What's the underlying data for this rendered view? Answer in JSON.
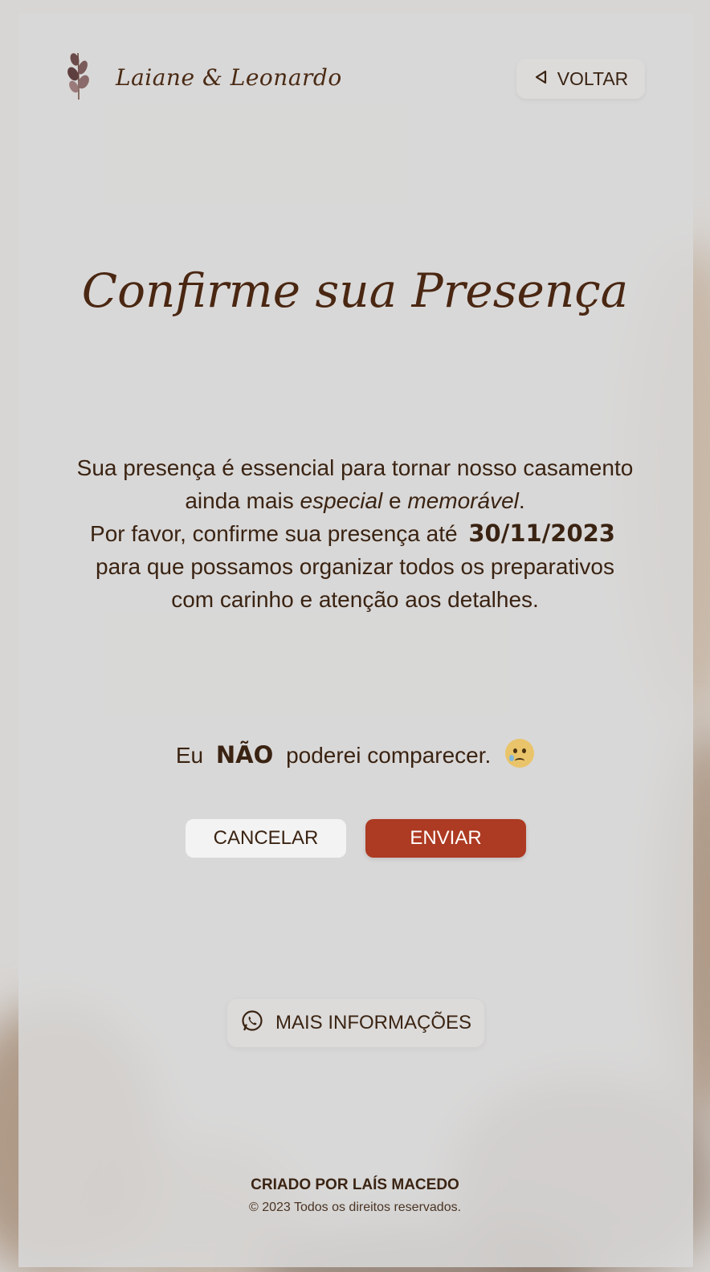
{
  "header": {
    "couple_name": "Laiane & Leonardo",
    "back_label": "VOLTAR"
  },
  "main": {
    "title": "Confirme sua Presença",
    "message": {
      "line1": "Sua presença é essencial para tornar nosso casamento ainda mais",
      "special": "especial",
      "and": "e",
      "memorable": "memorável",
      "period": ".",
      "line2_start": "Por favor, confirme sua presença até",
      "date": "30/11/2023",
      "line2_end": "para que possamos organizar todos os preparativos com carinho e atenção aos detalhes."
    },
    "decline": {
      "prefix": "Eu",
      "emphasis": "NÃO",
      "suffix": "poderei comparecer.",
      "emoji": "crying-face-icon"
    },
    "cancel_label": "CANCELAR",
    "send_label": "ENVIAR"
  },
  "info_button": {
    "label": "MAIS INFORMAÇÕES",
    "icon": "whatsapp-icon"
  },
  "footer": {
    "credit": "CRIADO POR LAÍS MACEDO",
    "copyright": "© 2023   Todos os direitos reservados."
  },
  "colors": {
    "primary_text": "#4a2712",
    "send_button": "#ad3a22",
    "cancel_button": "#f3f3f3"
  }
}
